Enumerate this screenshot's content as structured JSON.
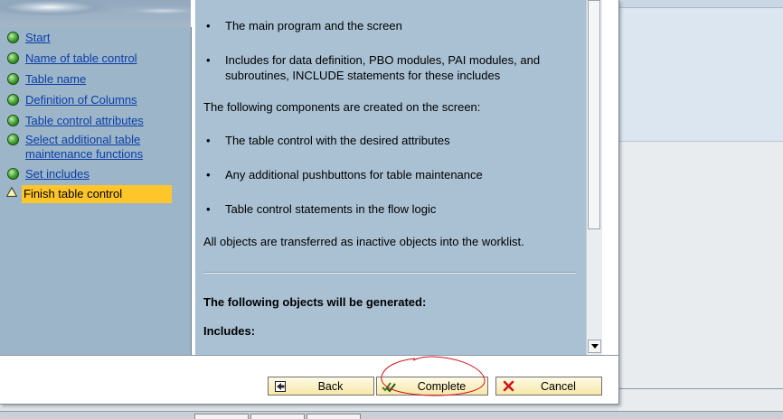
{
  "wizard": {
    "steps": [
      {
        "label": "Start",
        "status": "done"
      },
      {
        "label": "Name of table control",
        "status": "done"
      },
      {
        "label": "Table name",
        "status": "done"
      },
      {
        "label": "Definition of Columns",
        "status": "done"
      },
      {
        "label": "Table control attributes",
        "status": "done"
      },
      {
        "label": "Select additional table maintenance functions",
        "status": "done"
      },
      {
        "label": "Set includes",
        "status": "done"
      },
      {
        "label": "Finish table control",
        "status": "current"
      }
    ]
  },
  "content": {
    "bullets_program": [
      "The main program and the screen",
      "Includes for data definition, PBO modules, PAI modules, and subroutines, INCLUDE statements for these includes"
    ],
    "screen_intro": "The following components are created on the screen:",
    "bullets_screen": [
      "The table control with the desired attributes",
      "Any additional pushbuttons for table maintenance",
      "Table control statements in the flow logic"
    ],
    "inactive_note": "All objects are transferred as inactive objects into the worklist.",
    "generated_heading": "The following objects will be generated:",
    "includes_heading": "Includes:"
  },
  "buttons": {
    "back": "Back",
    "complete": "Complete",
    "cancel": "Cancel"
  },
  "colors": {
    "accent_current_step": "#ffc52a",
    "link": "#0b3fa8",
    "annotation": "#d0141c"
  }
}
